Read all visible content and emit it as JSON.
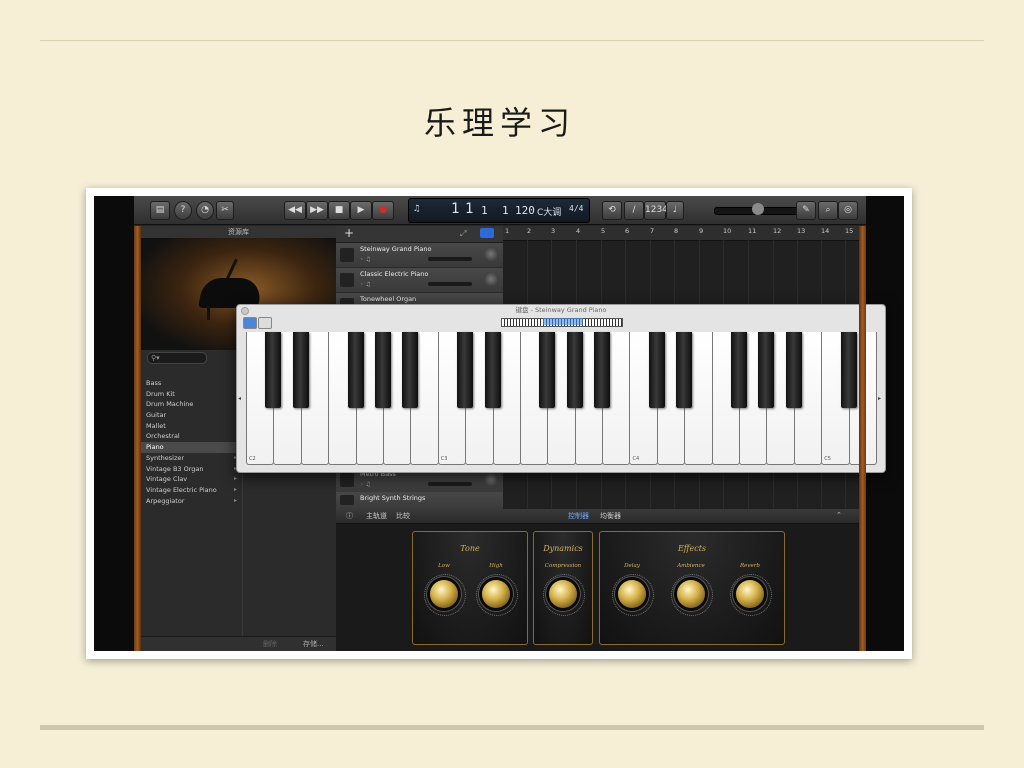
{
  "slide": {
    "title": "乐理学习"
  },
  "toolbar": {
    "lcd_bar": "1",
    "lcd_beat": "1",
    "lcd_div": "1",
    "lcd_tick": "1",
    "lcd_tempo": "120",
    "lcd_key": "C大调",
    "lcd_sig": "4/4",
    "count_in": "1234"
  },
  "library": {
    "header": "资源库",
    "items": [
      "Bass",
      "Drum Kit",
      "Drum Machine",
      "Guitar",
      "Mallet",
      "Orchestral",
      "Piano",
      "Synthesizer",
      "Vintage B3 Organ",
      "Vintage Clav",
      "Vintage Electric Piano",
      "Arpeggiator"
    ],
    "selected": "Piano",
    "footer_delete": "删除",
    "footer_save": "存储..."
  },
  "tracks": {
    "items": [
      "Steinway Grand Piano",
      "Classic Electric Piano",
      "Tonewheel Organ"
    ],
    "bottom_items": [
      "Metro Bass",
      "Bright Synth Strings"
    ]
  },
  "ruler": {
    "marks": [
      "1",
      "2",
      "3",
      "4",
      "5",
      "6",
      "7",
      "8",
      "9",
      "10",
      "11",
      "12",
      "13",
      "14",
      "15"
    ]
  },
  "keyboard_window": {
    "title": "键盘 - Steinway Grand Piano",
    "octave_labels": [
      "C2",
      "C3",
      "C4",
      "C5"
    ]
  },
  "smart_controls": {
    "tab_master": "主轨道",
    "tab_compare": "比较",
    "tab_controls": "控制器",
    "tab_eq": "均衡器",
    "panels": [
      {
        "title": "Tone",
        "knobs": [
          "Low",
          "High"
        ]
      },
      {
        "title": "Dynamics",
        "knobs": [
          "Compression"
        ]
      },
      {
        "title": "Effects",
        "knobs": [
          "Delay",
          "Ambience",
          "Reverb"
        ]
      }
    ]
  },
  "colors": {
    "slide_bg": "#f6efd6",
    "accent_blue": "#6ea8ff",
    "gold": "#d6b05a",
    "record_red": "#d22b2b"
  }
}
